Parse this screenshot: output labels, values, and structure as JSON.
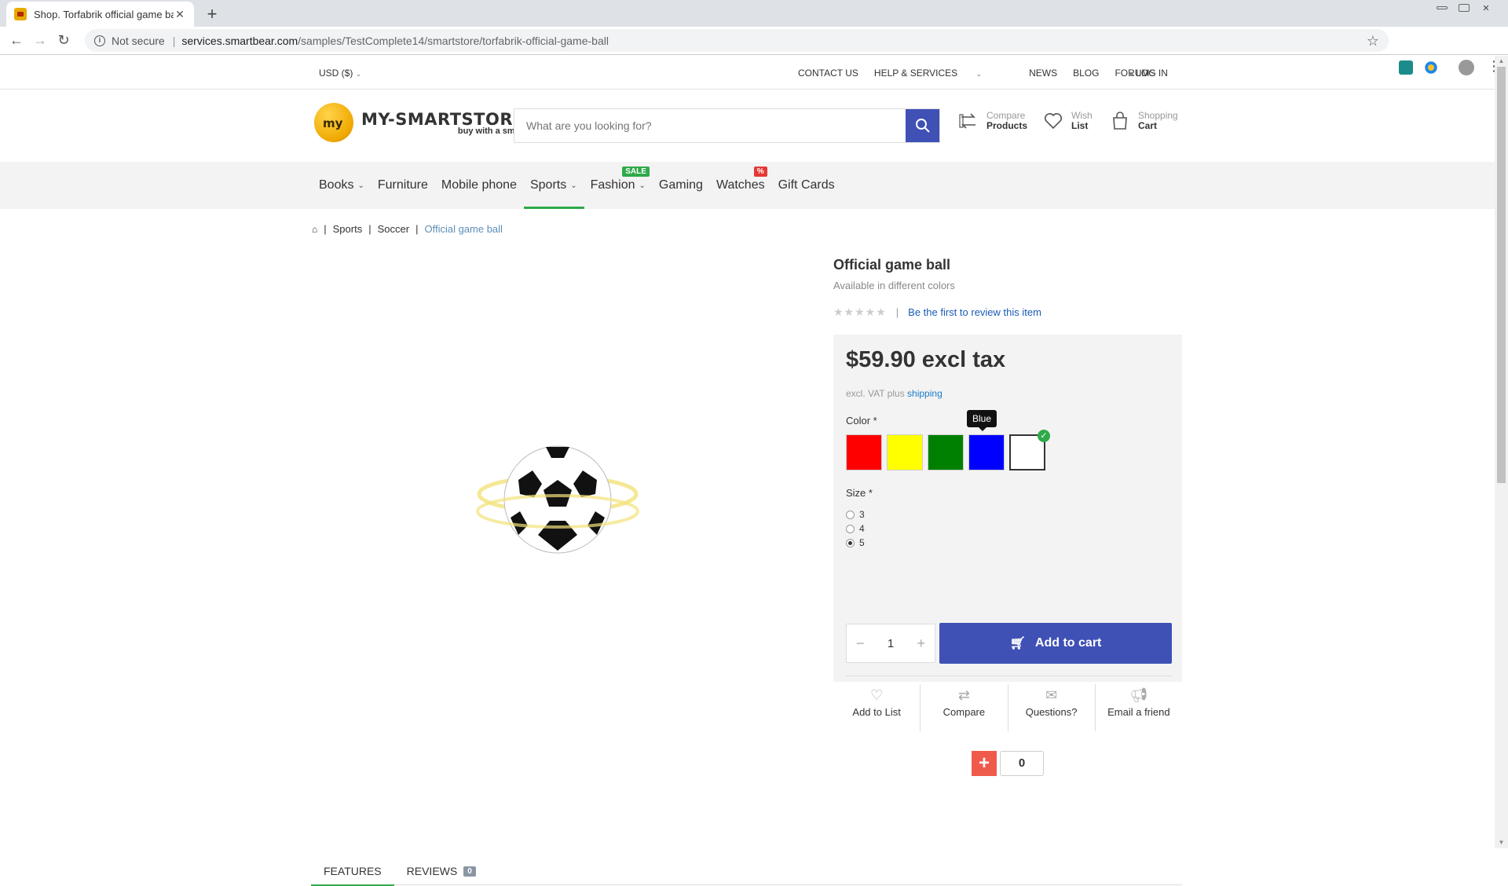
{
  "browser": {
    "tab_title": "Shop. Torfabrik official game ball",
    "not_secure": "Not secure",
    "url_host": "services.smartbear.com",
    "url_path": "/samples/TestComplete14/smartstore/torfabrik-official-game-ball"
  },
  "topbar": {
    "currency": "USD  ($)",
    "contact": "CONTACT US",
    "help": "HELP & SERVICES",
    "news": "NEWS",
    "blog": "BLOG",
    "forums": "FORUMS",
    "login": "LOG IN"
  },
  "header": {
    "brand": "MY-SMARTSTORE",
    "tagline": "buy with a smile",
    "search_placeholder": "What are you looking for?",
    "compare_l1": "Compare",
    "compare_l2": "Products",
    "wish_l1": "Wish",
    "wish_l2": "List",
    "cart_l1": "Shopping",
    "cart_l2": "Cart"
  },
  "menu": {
    "books": "Books",
    "furniture": "Furniture",
    "mobile": "Mobile phone",
    "sports": "Sports",
    "fashion": "Fashion",
    "fashion_badge": "SALE",
    "gaming": "Gaming",
    "watches": "Watches",
    "watches_badge": "%",
    "giftcards": "Gift Cards"
  },
  "breadcrumb": {
    "sports": "Sports",
    "soccer": "Soccer",
    "current": "Official game ball"
  },
  "product": {
    "title": "Official game ball",
    "subtitle": "Available in different colors",
    "review_link": "Be the first to review this item",
    "price": "$59.90 excl tax",
    "excl_text": "excl. VAT plus",
    "shipping_link": "shipping",
    "color_label": "Color *",
    "tooltip": "Blue",
    "size_label": "Size *",
    "sizes": [
      "3",
      "4",
      "5"
    ],
    "qty": "1",
    "add_to_cart": "Add to cart",
    "colors": {
      "red": "#ff0000",
      "yellow": "#ffff00",
      "green": "#008000",
      "blue": "#0000ff",
      "white": "#ffffff"
    }
  },
  "actions": {
    "add_to_list": "Add to List",
    "compare": "Compare",
    "questions": "Questions?",
    "email": "Email a friend"
  },
  "share": {
    "count": "0"
  },
  "tabs": {
    "features": "FEATURES",
    "reviews": "REVIEWS",
    "reviews_count": "0"
  }
}
